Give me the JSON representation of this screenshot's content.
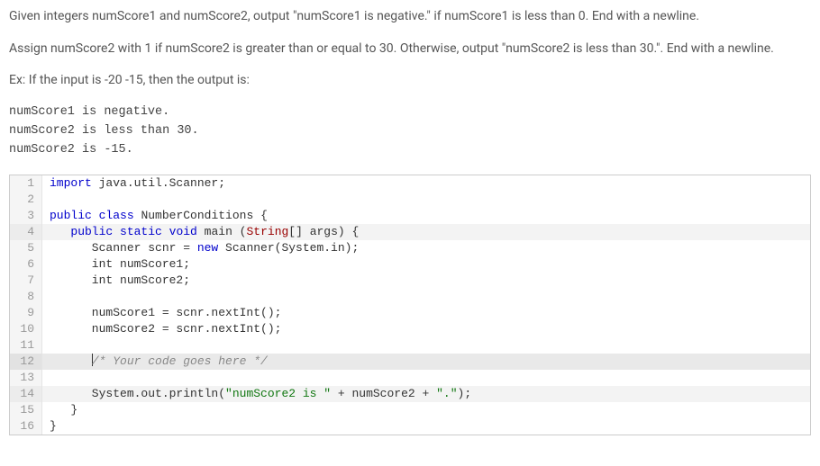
{
  "problem": {
    "p1": "Given integers numScore1 and numScore2, output \"numScore1 is negative.\" if numScore1 is less than 0. End with a newline.",
    "p2": "Assign numScore2 with 1 if numScore2 is greater than or equal to 30. Otherwise, output \"numScore2 is less than 30.\". End with a newline.",
    "p3": "Ex: If the input is -20 -15, then the output is:",
    "out1": "numScore1 is negative.",
    "out2": "numScore2 is less than 30.",
    "out3": "numScore2 is -15."
  },
  "code": {
    "l1_a": "import",
    "l1_b": " java.util.Scanner;",
    "l3_a": "public",
    "l3_b": " ",
    "l3_c": "class",
    "l3_d": " NumberConditions {",
    "l4_a": "   ",
    "l4_b": "public",
    "l4_c": " ",
    "l4_d": "static",
    "l4_e": " ",
    "l4_f": "void",
    "l4_g": " main (",
    "l4_h": "String",
    "l4_i": "[] args) {",
    "l5_a": "      Scanner scnr = ",
    "l5_b": "new",
    "l5_c": " Scanner(System.in);",
    "l6": "      int numScore1;",
    "l7": "      int numScore2;",
    "l9": "      numScore1 = scnr.nextInt();",
    "l10": "      numScore2 = scnr.nextInt();",
    "l12_a": "      ",
    "l12_b": "/* Your code goes here */",
    "l14_a": "      System.out.println(",
    "l14_b": "\"numScore2 is \"",
    "l14_c": " + numScore2 + ",
    "l14_d": "\".\"",
    "l14_e": ");",
    "l15": "   }",
    "l16": "}"
  },
  "lineNumbers": [
    "1",
    "2",
    "3",
    "4",
    "5",
    "6",
    "7",
    "8",
    "9",
    "10",
    "11",
    "12",
    "13",
    "14",
    "15",
    "16"
  ]
}
